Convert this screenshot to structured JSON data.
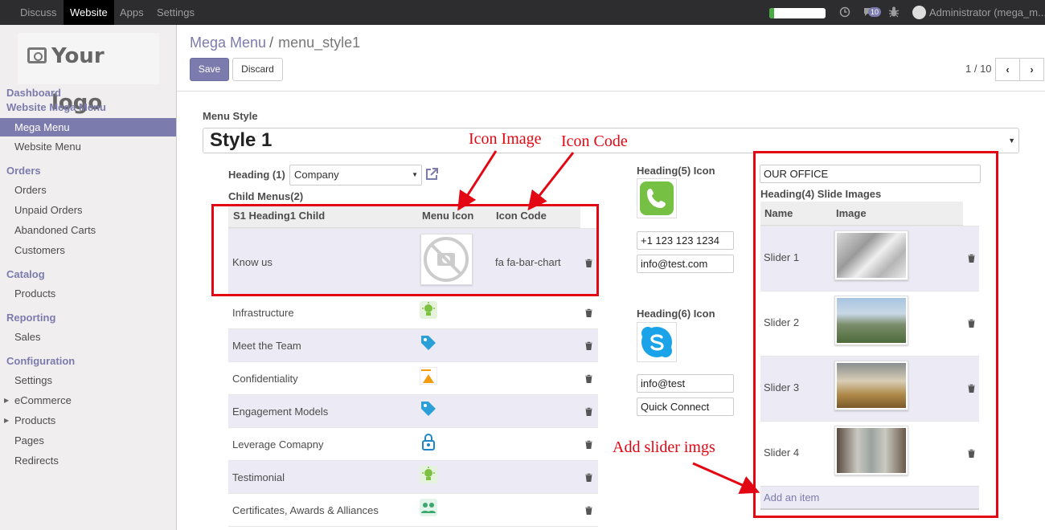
{
  "topbar": {
    "menus": [
      "Discuss",
      "Website",
      "Apps",
      "Settings"
    ],
    "active_menu": "Website",
    "progress": 0.08,
    "message_count": "10",
    "user": "Administrator (mega_m..."
  },
  "sidebar": {
    "logo_text": "Your logo",
    "sections": [
      {
        "title": "Dashboard",
        "items": []
      },
      {
        "title": "Website Mega Menu",
        "items": [
          "Mega Menu",
          "Website Menu"
        ]
      },
      {
        "title": "Orders",
        "items": [
          "Orders",
          "Unpaid Orders",
          "Abandoned Carts",
          "Customers"
        ]
      },
      {
        "title": "Catalog",
        "items": [
          "Products"
        ]
      },
      {
        "title": "Reporting",
        "items": [
          "Sales"
        ]
      },
      {
        "title": "Configuration",
        "items": [
          "Settings",
          "eCommerce",
          "Products",
          "Pages",
          "Redirects"
        ]
      }
    ],
    "active_item": "Mega Menu"
  },
  "breadcrumb": {
    "parent": "Mega Menu",
    "separator": "/",
    "current": "menu_style1"
  },
  "buttons": {
    "save": "Save",
    "discard": "Discard"
  },
  "pager": {
    "text": "1 / 10"
  },
  "form": {
    "menu_style_label": "Menu Style",
    "menu_style_value": "Style 1",
    "heading1_label": "Heading (1)",
    "heading1_value": "Company",
    "child_menus_label": "Child Menus(2)",
    "child_table": {
      "columns": [
        "S1 Heading1 Child",
        "Menu Icon",
        "Icon Code"
      ],
      "rows": [
        {
          "name": "Know us",
          "icon": "no-image-icon",
          "code": "fa fa-bar-chart"
        },
        {
          "name": "Infrastructure",
          "icon": "bulb-icon",
          "code": ""
        },
        {
          "name": "Meet the Team",
          "icon": "tag-icon",
          "code": ""
        },
        {
          "name": "Confidentiality",
          "icon": "warning-icon",
          "code": ""
        },
        {
          "name": "Engagement Models",
          "icon": "tag-icon",
          "code": ""
        },
        {
          "name": "Leverage Comapny",
          "icon": "lock-icon",
          "code": ""
        },
        {
          "name": "Testimonial",
          "icon": "bulb-icon",
          "code": ""
        },
        {
          "name": "Certificates, Awards & Alliances",
          "icon": "team-icon",
          "code": ""
        }
      ]
    },
    "heading5_label": "Heading(5) Icon",
    "heading5_icon": "phone-icon",
    "phone": "+1 123 123 1234",
    "email1": "info@test.com",
    "heading6_label": "Heading(6) Icon",
    "heading6_icon": "skype-icon",
    "skype_id": "info@test",
    "skype_text": "Quick Connect",
    "office_value": "OUR OFFICE",
    "heading4_label": "Heading(4) Slide Images",
    "slide_table": {
      "columns": [
        "Name",
        "Image"
      ],
      "rows": [
        "Slider 1",
        "Slider 2",
        "Slider 3",
        "Slider 4"
      ],
      "add_item": "Add an item"
    }
  },
  "annotations": {
    "icon_image": "Icon Image",
    "icon_code": "Icon Code",
    "add_slider": "Add slider imgs",
    "color": "#e30613"
  },
  "colors": {
    "brand": "#7c7bad",
    "topbar": "#2d2d2f"
  }
}
